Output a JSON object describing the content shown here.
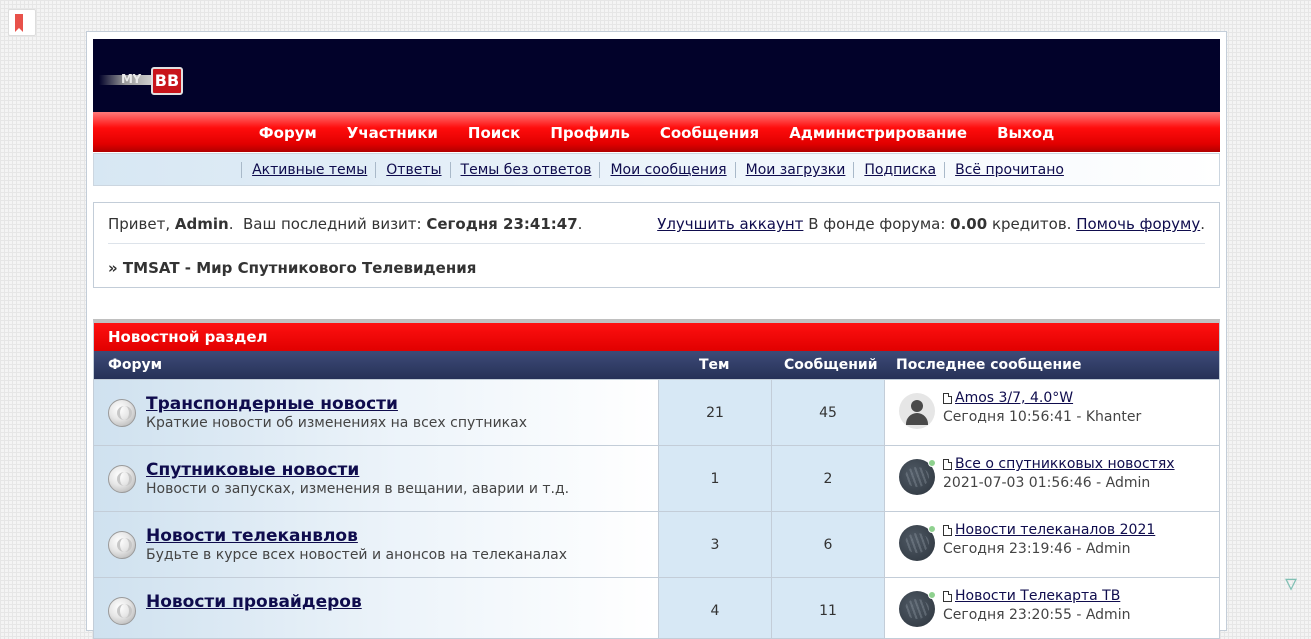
{
  "header": {
    "logo_text": "MY",
    "logo_badge": "BB"
  },
  "menu": [
    "Форум",
    "Участники",
    "Поиск",
    "Профиль",
    "Сообщения",
    "Администрирование",
    "Выход"
  ],
  "submenu": [
    "Активные темы",
    "Ответы",
    "Темы без ответов",
    "Мои сообщения",
    "Мои загрузки",
    "Подписка",
    "Всё прочитано"
  ],
  "welcome": {
    "greeting": "Привет,",
    "username": "Admin",
    "last_visit_label": "Ваш последний визит:",
    "last_visit_value": "Сегодня 23:41:47",
    "upgrade_link": "Улучшить аккаунт",
    "fund_label": "В фонде форума:",
    "fund_value": "0.00",
    "fund_unit": "кредитов.",
    "donate_link": "Помочь форуму",
    "breadcrumb": "» TMSAT - Мир Спутникового Телевидения"
  },
  "section": {
    "title": "Новостной раздел",
    "columns": {
      "forum": "Форум",
      "topics": "Тем",
      "posts": "Сообщений",
      "last_post": "Последнее сообщение"
    },
    "forums": [
      {
        "name": "Транспондерные новости",
        "description": "Краткие новости об изменениях на всех спутниках",
        "topics": "21",
        "posts": "45",
        "last_title": "Amos 3/7, 4.0°W",
        "last_meta": "Сегодня 10:56:41 - Khanter",
        "avatar": "default-user-icon",
        "online": false
      },
      {
        "name": "Спутниковые новости",
        "description": "Новости о запусках, изменения в вещании, аварии и т.д.",
        "topics": "1",
        "posts": "2",
        "last_title": "Все о спутникковых новостях",
        "last_meta": "2021-07-03 01:56:46 - Admin",
        "avatar": "admin-avatar",
        "online": true
      },
      {
        "name": "Новости телеканвлов",
        "description": "Будьте в курсе всех новостей и анонсов на телеканалах",
        "topics": "3",
        "posts": "6",
        "last_title": "Новости телеканалов 2021",
        "last_meta": "Сегодня 23:19:46 - Admin",
        "avatar": "admin-avatar",
        "online": true
      },
      {
        "name": "Новости провайдеров",
        "description": "",
        "topics": "4",
        "posts": "11",
        "last_title": "Новости Телекарта ТВ",
        "last_meta": "Сегодня 23:20:55 - Admin",
        "avatar": "admin-avatar",
        "online": true
      }
    ]
  },
  "colors": {
    "header_bg": "#02022a",
    "menu_red": "#ff0c0c",
    "category_bar": "#263157",
    "count_cells": "#d7e8f5",
    "link": "#0f0c4d"
  }
}
